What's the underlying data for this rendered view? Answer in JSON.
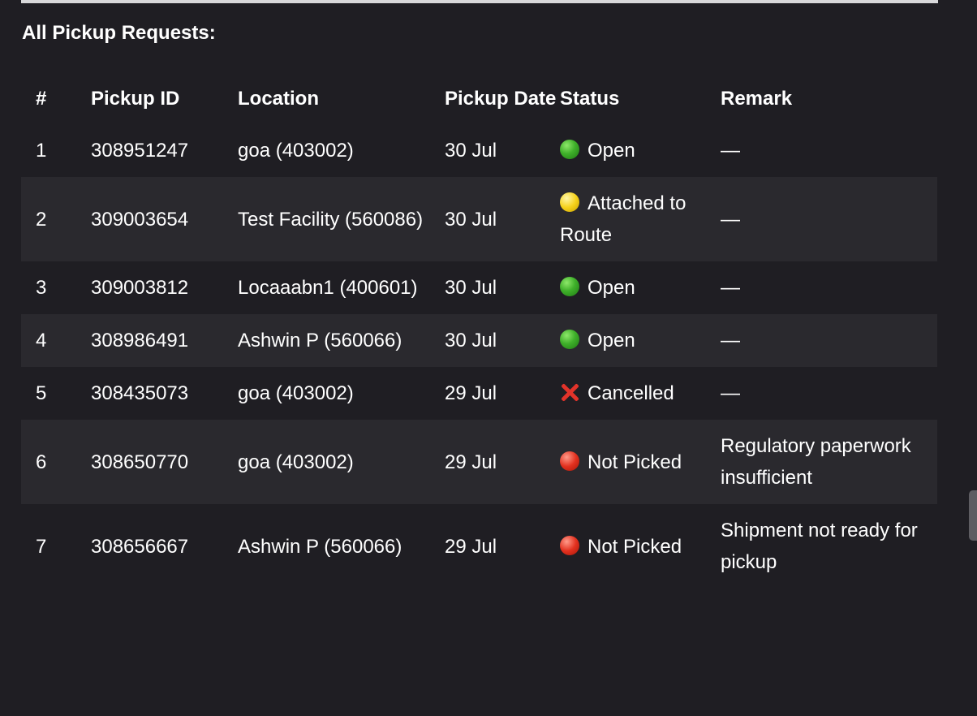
{
  "heading": "All Pickup Requests:",
  "columns": {
    "index": "#",
    "pickup_id": "Pickup ID",
    "location": "Location",
    "pickup_date": "Pickup Date",
    "status": "Status",
    "remark": "Remark"
  },
  "status_colors": {
    "open": "#3fb02a",
    "attached": "#f5d21c",
    "not_picked": "#e3311f",
    "cancelled": "#e2332a"
  },
  "rows": [
    {
      "index": "1",
      "pickup_id": "308951247",
      "location": "goa (403002)",
      "date": "30 Jul",
      "status_icon": "green-circle-icon",
      "status": "Open",
      "remark": "—"
    },
    {
      "index": "2",
      "pickup_id": "309003654",
      "location": "Test Facility (560086)",
      "date": "30 Jul",
      "status_icon": "yellow-circle-icon",
      "status": "Attached to Route",
      "remark": "—"
    },
    {
      "index": "3",
      "pickup_id": "309003812",
      "location": "Locaaabn1 (400601)",
      "date": "30 Jul",
      "status_icon": "green-circle-icon",
      "status": "Open",
      "remark": "—"
    },
    {
      "index": "4",
      "pickup_id": "308986491",
      "location": "Ashwin P (560066)",
      "date": "30 Jul",
      "status_icon": "green-circle-icon",
      "status": "Open",
      "remark": "—"
    },
    {
      "index": "5",
      "pickup_id": "308435073",
      "location": "goa (403002)",
      "date": "29 Jul",
      "status_icon": "cross-mark-icon",
      "status": "Cancelled",
      "remark": "—"
    },
    {
      "index": "6",
      "pickup_id": "308650770",
      "location": "goa (403002)",
      "date": "29 Jul",
      "status_icon": "red-circle-icon",
      "status": "Not Picked",
      "remark": "Regulatory paperwork insufficient"
    },
    {
      "index": "7",
      "pickup_id": "308656667",
      "location": "Ashwin P (560066)",
      "date": "29 Jul",
      "status_icon": "red-circle-icon",
      "status": "Not Picked",
      "remark": "Shipment not ready for pickup"
    }
  ]
}
